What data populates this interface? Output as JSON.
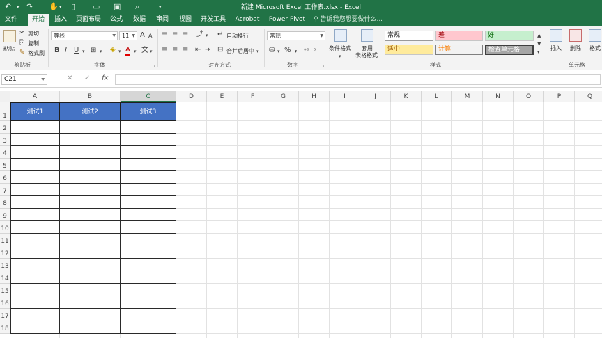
{
  "window": {
    "title": "新建 Microsoft Excel 工作表.xlsx - Excel"
  },
  "quick_access": {
    "undo_icon": "undo-icon",
    "redo_icon": "redo-icon",
    "touch_mode_icon": "touch-mode-icon",
    "new_icon": "new-file-icon",
    "open_icon": "open-folder-icon",
    "save_icon": "save-icon",
    "print_preview_icon": "print-preview-icon",
    "customize_icon": "customize-dropdown-icon"
  },
  "tabs": [
    "文件",
    "开始",
    "插入",
    "页面布局",
    "公式",
    "数据",
    "审阅",
    "视图",
    "开发工具",
    "Acrobat",
    "Power Pivot"
  ],
  "active_tab": "开始",
  "tell_me": "告诉我您想要做什么...",
  "ribbon": {
    "clipboard": {
      "paste": "粘贴",
      "cut": "剪切",
      "copy": "复制",
      "format_painter": "格式刷",
      "label": "剪贴板"
    },
    "font": {
      "name": "等线",
      "size": "11",
      "grow": "A",
      "shrink": "A",
      "bold": "B",
      "italic": "I",
      "underline": "U",
      "font_color_glyph": "A",
      "wen": "文",
      "label": "字体"
    },
    "alignment": {
      "wrap_text": "自动换行",
      "merge_center": "合并后居中",
      "label": "对齐方式"
    },
    "number": {
      "format": "常规",
      "percent": "%",
      "comma": ",",
      "label": "数字"
    },
    "styles": {
      "conditional_format": "条件格式",
      "table_format_line1": "套用",
      "table_format_line2": "表格格式",
      "normal": "常规",
      "bad": "差",
      "good": "好",
      "neutral": "适中",
      "calculation": "计算",
      "check_cell": "检查单元格",
      "label": "样式"
    },
    "cells": {
      "insert": "插入",
      "delete": "删除",
      "format": "格式",
      "label": "单元格"
    },
    "colors": {
      "ribbon_green": "#217346",
      "bad_bg": "#ffc7ce",
      "bad_fg": "#9c0006",
      "good_bg": "#c6efce",
      "good_fg": "#006100",
      "neutral_bg": "#ffeb9c",
      "neutral_fg": "#9c5700",
      "calc_bg": "#f2f2f2",
      "calc_fg": "#fa7d00",
      "check_bg": "#a5a5a5",
      "header_fill": "#4472c4"
    }
  },
  "formula_bar": {
    "name_box": "C21",
    "cancel_glyph": "✕",
    "enter_glyph": "✓",
    "fx": "fx",
    "content": ""
  },
  "sheet": {
    "columns": [
      "A",
      "B",
      "C",
      "D",
      "E",
      "F",
      "G",
      "H",
      "I",
      "J",
      "K",
      "L",
      "M",
      "N",
      "O",
      "P",
      "Q"
    ],
    "selected_column": "C",
    "rows": [
      "1",
      "2",
      "3",
      "4",
      "5",
      "6",
      "7",
      "8",
      "9",
      "10",
      "11",
      "12",
      "13",
      "14",
      "15",
      "16",
      "17",
      "18"
    ],
    "table_headers": [
      "测试1",
      "测试2",
      "测试3"
    ]
  }
}
